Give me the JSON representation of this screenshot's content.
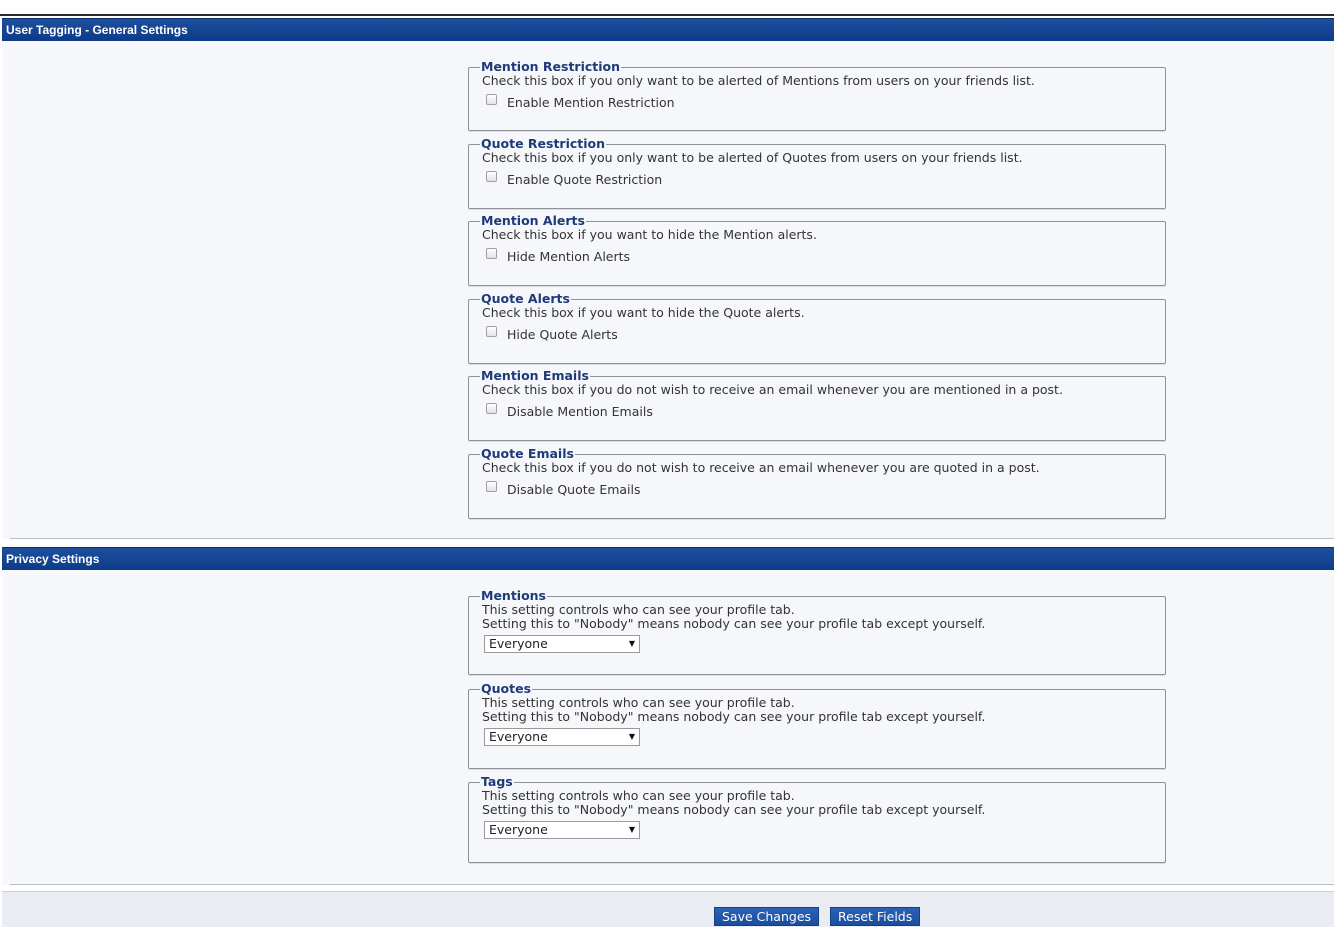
{
  "general_settings": {
    "header": "User Tagging - General Settings",
    "options": [
      {
        "legend": "Mention Restriction",
        "description": "Check this box if you only want to be alerted of Mentions from users on your friends list.",
        "checkbox_label": "Enable Mention Restriction",
        "checked": false
      },
      {
        "legend": "Quote Restriction",
        "description": "Check this box if you only want to be alerted of Quotes from users on your friends list.",
        "checkbox_label": "Enable Quote Restriction",
        "checked": false
      },
      {
        "legend": "Mention Alerts",
        "description": "Check this box if you want to hide the Mention alerts.",
        "checkbox_label": "Hide Mention Alerts",
        "checked": false
      },
      {
        "legend": "Quote Alerts",
        "description": "Check this box if you want to hide the Quote alerts.",
        "checkbox_label": "Hide Quote Alerts",
        "checked": false
      },
      {
        "legend": "Mention Emails",
        "description": "Check this box if you do not wish to receive an email whenever you are mentioned in a post.",
        "checkbox_label": "Disable Mention Emails",
        "checked": false
      },
      {
        "legend": "Quote Emails",
        "description": "Check this box if you do not wish to receive an email whenever you are quoted in a post.",
        "checkbox_label": "Disable Quote Emails",
        "checked": false
      }
    ]
  },
  "privacy_settings": {
    "header": "Privacy Settings",
    "options": [
      {
        "legend": "Mentions",
        "description_line1": "This setting controls who can see your profile tab.",
        "description_line2": "Setting this to \"Nobody\" means nobody can see your profile tab except yourself.",
        "selected": "Everyone"
      },
      {
        "legend": "Quotes",
        "description_line1": "This setting controls who can see your profile tab.",
        "description_line2": "Setting this to \"Nobody\" means nobody can see your profile tab except yourself.",
        "selected": "Everyone"
      },
      {
        "legend": "Tags",
        "description_line1": "This setting controls who can see your profile tab.",
        "description_line2": "Setting this to \"Nobody\" means nobody can see your profile tab except yourself.",
        "selected": "Everyone"
      }
    ]
  },
  "footer": {
    "save_label": "Save Changes",
    "reset_label": "Reset Fields"
  },
  "colors": {
    "header_blue": "#0d3b8a",
    "legend_text": "#1f3a78",
    "button_blue": "#1b4d9e",
    "panel_bg": "#f5f7fb"
  },
  "icons": {
    "select_arrow": "triangle-down-icon"
  }
}
